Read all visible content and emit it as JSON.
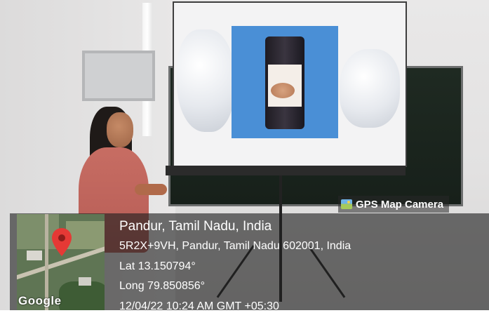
{
  "badge": {
    "label": "GPS Map Camera",
    "icon": "camera-map-icon"
  },
  "map": {
    "brand": "Google",
    "marker_icon": "map-pin-icon",
    "marker_color": "#e53935"
  },
  "location": {
    "place": "Pandur, Tamil Nadu, India",
    "address": "5R2X+9VH, Pandur, Tamil Nadu 602001, India",
    "lat": "Lat 13.150794°",
    "long": "Long 79.850856°",
    "datetime": "12/04/22 10:24 AM GMT +05:30"
  }
}
